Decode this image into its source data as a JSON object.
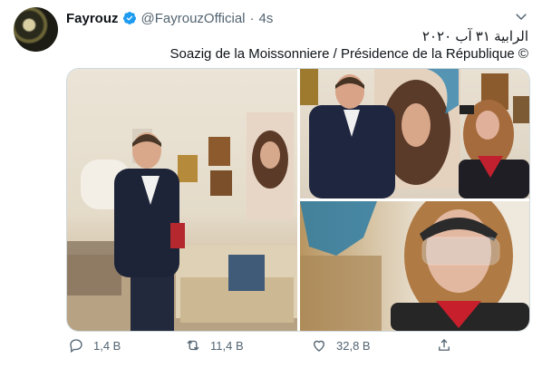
{
  "tweet": {
    "display_name": "Fayrouz",
    "handle": "@FayrouzOfficial",
    "separator": "·",
    "time": "4s",
    "text_line1": "الرابية ٣١ آب ٢٠٢٠",
    "text_line2": "Soazig de la Moissonniere / Présidence de la République ©"
  },
  "actions": {
    "reply_count": "1,4 B",
    "retweet_count": "11,4 B",
    "like_count": "32,8 B"
  },
  "icons": [
    "avatar",
    "verified-badge-icon",
    "chevron-down-icon",
    "reply-icon",
    "retweet-icon",
    "like-icon",
    "share-icon"
  ],
  "colors": {
    "text": "#0f1419",
    "secondary": "#536471",
    "verified": "#1d9bf0",
    "border": "#cfd9de"
  }
}
